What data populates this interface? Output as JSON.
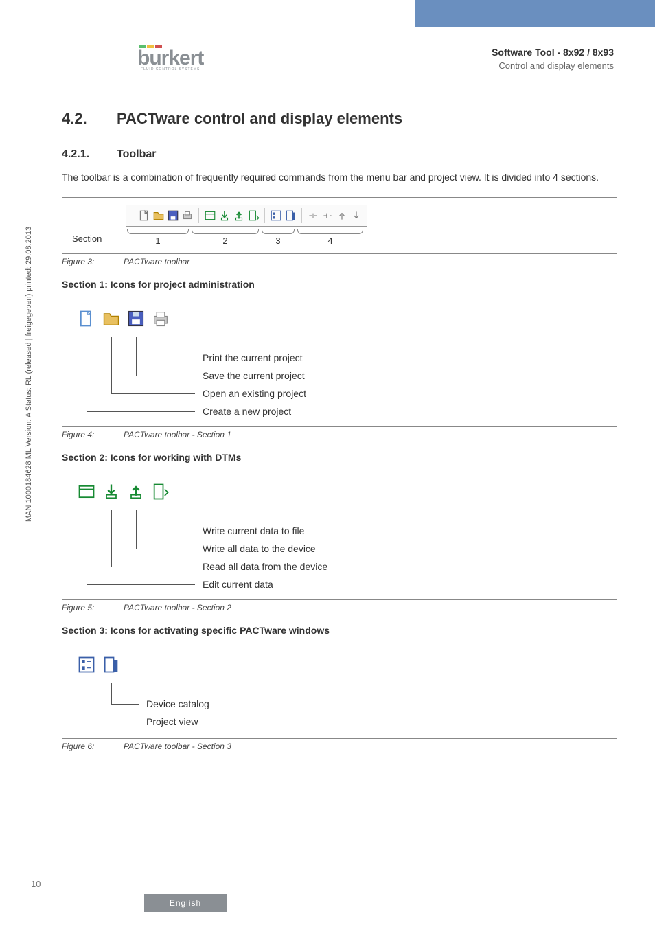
{
  "header": {
    "logo_word": "burkert",
    "logo_sub": "FLUID CONTROL SYSTEMS",
    "title": "Software Tool - 8x92 / 8x93",
    "subtitle": "Control and display elements"
  },
  "sidetext": "MAN 1000184628 ML Version: A Status: RL (released | freigegeben) printed: 29.08.2013",
  "page_num": "10",
  "h2_num": "4.2.",
  "h2_text": "PACTware control and display elements",
  "h3_num": "4.2.1.",
  "h3_text": "Toolbar",
  "intro": "The toolbar is a combination of frequently required commands from the menu bar and project view. It is divided into 4 sections.",
  "fig3": {
    "section_label": "Section",
    "nums": [
      "1",
      "2",
      "3",
      "4"
    ],
    "caption_n": "Figure 3:",
    "caption_t": "PACTware toolbar"
  },
  "sec1_title": "Section 1: Icons for project administration",
  "sec1_items": [
    "Print the current project",
    "Save the current project",
    "Open an existing project",
    "Create a new project"
  ],
  "fig4": {
    "caption_n": "Figure 4:",
    "caption_t": "PACTware toolbar - Section 1"
  },
  "sec2_title": "Section 2: Icons for working with DTMs",
  "sec2_items": [
    "Write current data to file",
    "Write all data to the device",
    "Read all data from the device",
    "Edit current data"
  ],
  "fig5": {
    "caption_n": "Figure 5:",
    "caption_t": "PACTware toolbar - Section 2"
  },
  "sec3_title": "Section 3: Icons for activating specific PACTware windows",
  "sec3_items": [
    "Device catalog",
    "Project view"
  ],
  "fig6": {
    "caption_n": "Figure 6:",
    "caption_t": "PACTware toolbar - Section 3"
  },
  "footer": "English"
}
